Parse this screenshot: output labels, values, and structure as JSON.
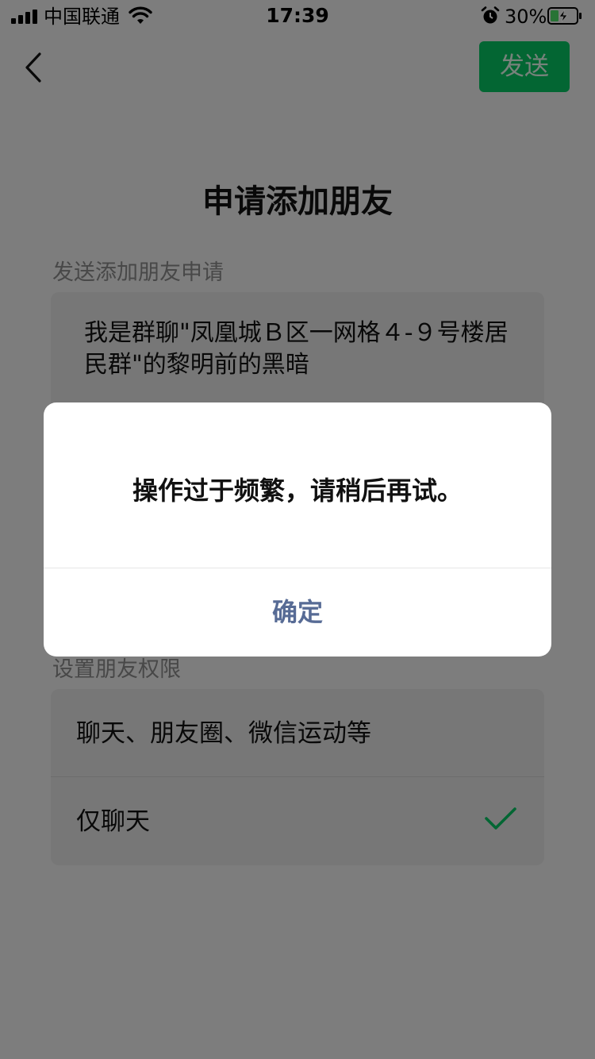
{
  "status_bar": {
    "carrier": "中国联通",
    "time": "17:39",
    "battery_percent": "30%",
    "icons": [
      "signal-icon",
      "wifi-icon",
      "alarm-icon",
      "battery-charging-icon"
    ]
  },
  "nav": {
    "back_icon": "chevron-left-icon",
    "send_label": "发送"
  },
  "page": {
    "title": "申请添加朋友",
    "request_section_label": "发送添加朋友申请",
    "request_message": "我是群聊\"凤凰城Ｂ区一网格４-９号楼居民群\"的黎明前的黑暗",
    "permissions_section_label": "设置朋友权限",
    "permissions": [
      {
        "label": "聊天、朋友圈、微信运动等",
        "selected": false
      },
      {
        "label": "仅聊天",
        "selected": true
      }
    ]
  },
  "dialog": {
    "message": "操作过于频繁，请稍后再试。",
    "ok_label": "确定"
  },
  "colors": {
    "accent_green": "#07c160",
    "link_blue": "#576b95",
    "background": "#ededed"
  }
}
